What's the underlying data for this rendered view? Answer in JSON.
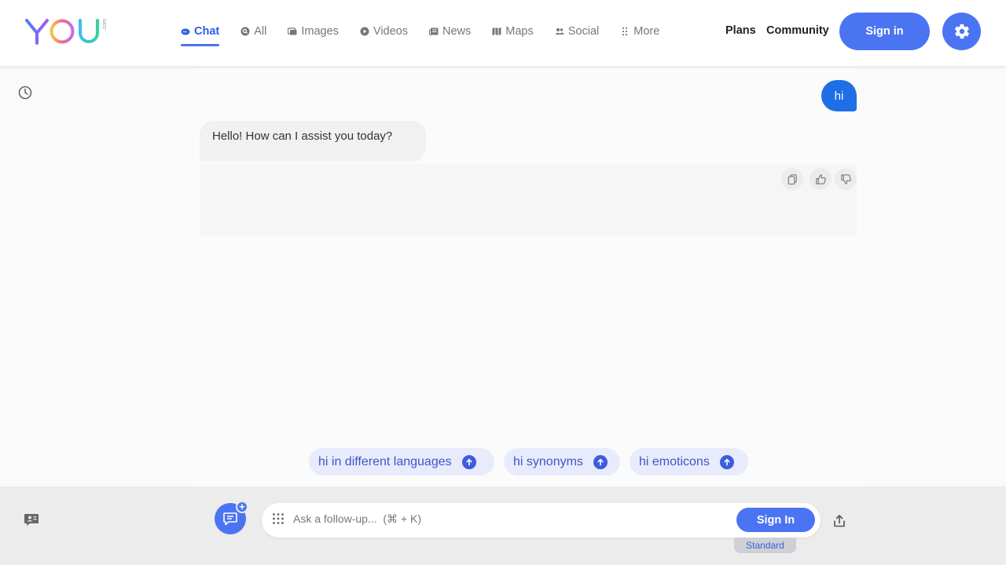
{
  "header": {
    "logo": {
      "text": "YOU",
      "suffix": ".com"
    },
    "nav": [
      {
        "label": "Chat",
        "icon": "chat-icon",
        "active": true
      },
      {
        "label": "All",
        "icon": "search-icon",
        "active": false
      },
      {
        "label": "Images",
        "icon": "images-icon",
        "active": false
      },
      {
        "label": "Videos",
        "icon": "play-icon",
        "active": false
      },
      {
        "label": "News",
        "icon": "newspaper-icon",
        "active": false
      },
      {
        "label": "Maps",
        "icon": "map-icon",
        "active": false
      },
      {
        "label": "Social",
        "icon": "people-icon",
        "active": false
      },
      {
        "label": "More",
        "icon": "dots-grid-icon",
        "active": false
      }
    ],
    "plans_label": "Plans",
    "community_label": "Community",
    "signin_label": "Sign in"
  },
  "conversation": {
    "user_message": "hi",
    "assistant_message": "Hello! How can I assist you today?"
  },
  "suggestions": [
    "hi in different languages",
    "hi synonyms",
    "hi emoticons"
  ],
  "composer": {
    "placeholder": "Ask a follow-up...  (⌘ + K)",
    "value": "",
    "signin_label": "Sign In",
    "mode": "Standard"
  },
  "colors": {
    "accent": "#4b74f2",
    "user_bubble": "#1e6fe6",
    "suggestion_bg": "#e8ebfb",
    "suggestion_text": "#3e56c9"
  }
}
